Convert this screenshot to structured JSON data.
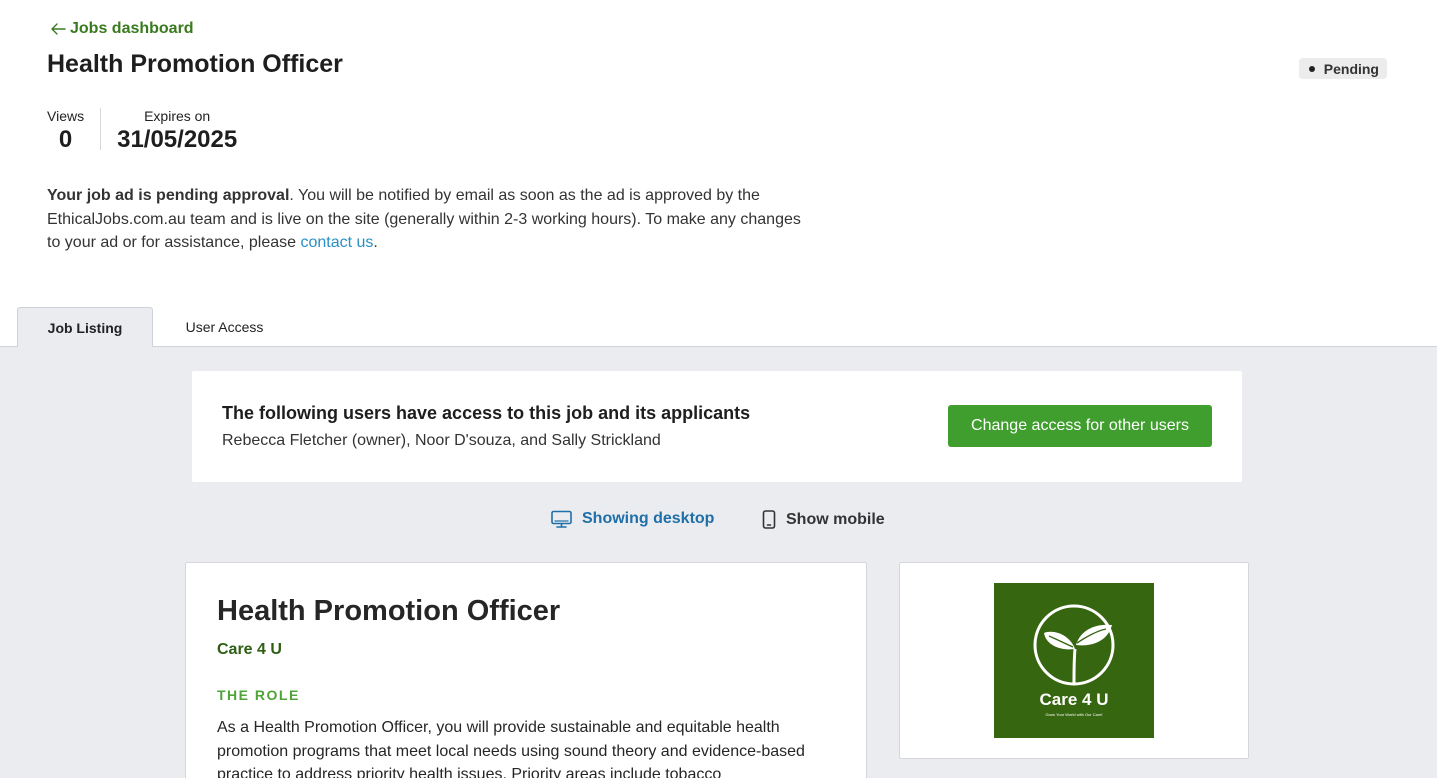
{
  "header": {
    "back_label": "Jobs dashboard",
    "title": "Health Promotion Officer",
    "status": "Pending"
  },
  "stats": {
    "views_label": "Views",
    "views_value": "0",
    "expires_label": "Expires on",
    "expires_value": "31/05/2025"
  },
  "notice": {
    "bold": "Your job ad is pending approval",
    "text": ". You will be notified by email as soon as the ad is approved by the EthicalJobs.com.au team and is live on the site (generally within 2-3 working hours). To make any changes to your ad or for assistance, please ",
    "link": "contact us",
    "end": "."
  },
  "tabs": [
    {
      "label": "Job Listing",
      "active": true
    },
    {
      "label": "User Access",
      "active": false
    }
  ],
  "access": {
    "title": "The following users have access to this job and its applicants",
    "users": "Rebecca Fletcher (owner), Noor D'souza, and Sally Strickland",
    "button_label": "Change access for other users"
  },
  "view_toggle": {
    "desktop_label": "Showing desktop",
    "mobile_label": "Show mobile"
  },
  "job": {
    "title": "Health Promotion Officer",
    "company": "Care 4 U",
    "section_heading": "THE ROLE",
    "body": "As a Health Promotion Officer, you will provide sustainable and equitable health promotion programs that meet local needs using sound theory and evidence-based practice to address priority health issues. Priority areas include tobacco"
  },
  "logo": {
    "name": "Care 4 U",
    "tagline": "Grow Your World with Our Care!"
  },
  "colors": {
    "accent_green": "#3f9e2d",
    "link_blue": "#2a8fc4",
    "logo_green": "#376610"
  }
}
